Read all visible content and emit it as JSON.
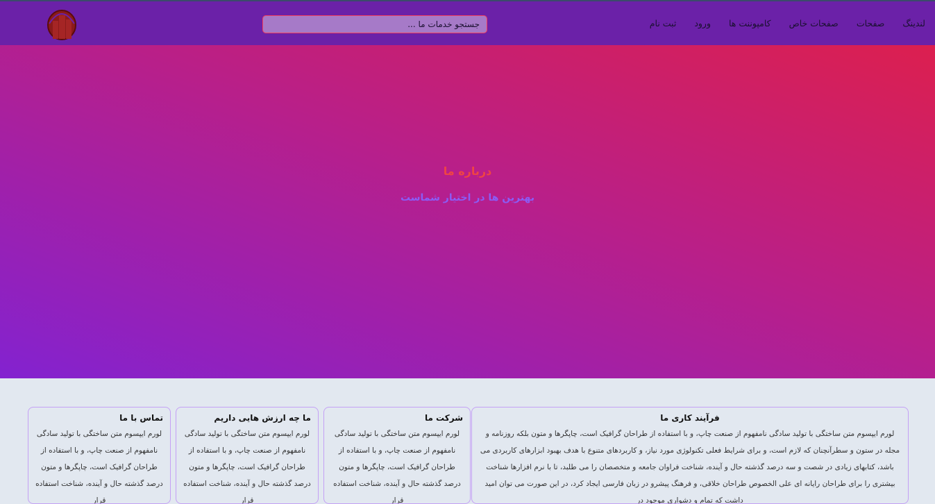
{
  "nav": {
    "menu": [
      "لندینگ",
      "صفحات",
      "صفحات خاص",
      "کامپوننت ها",
      "ورود",
      "ثبت نام"
    ],
    "search_placeholder": "جستجو خدمات ما ..."
  },
  "hero": {
    "title": "درباره ما",
    "subtitle": "بهترین ها در اختیار شماست"
  },
  "cards": [
    {
      "title": "فرآیند کاری ما",
      "text": "لورم ایپسوم متن ساختگی با تولید سادگی نامفهوم از صنعت چاپ، و با استفاده از طراحان گرافیک است، چاپگرها و متون بلکه روزنامه و مجله در ستون و سطرآنچنان که لازم است، و برای شرایط فعلی تکنولوژی مورد نیاز، و کاربردهای متنوع با هدف بهبود ابزارهای کاربردی می باشد، کتابهای زیادی در شصت و سه درصد گذشته حال و آینده، شناخت فراوان جامعه و متخصصان را می طلبد، تا با نرم افزارها شناخت بیشتری را برای طراحان رایانه ای علی الخصوص طراحان خلاقی، و فرهنگ پیشرو در زبان فارسی ایجاد کرد، در این صورت می توان امید داشت که تمام و دشواری موجود در"
    },
    {
      "title": "شرکت ما",
      "text": "لورم ایپسوم متن ساختگی با تولید سادگی نامفهوم از صنعت چاپ، و با استفاده از طراحان گرافیک است، چاپگرها و متون درصد گذشته حال و آینده، شناخت استفاده قرار"
    },
    {
      "title": "ما چه ارزش هایی داریم",
      "text": "لورم ایپسوم متن ساختگی با تولید سادگی نامفهوم از صنعت چاپ، و با استفاده از طراحان گرافیک است، چاپگرها و متون درصد گذشته حال و آینده، شناخت استفاده قرار"
    },
    {
      "title": "تماس با ما",
      "text": "لورم ایپسوم متن ساختگی با تولید سادگی نامفهوم از صنعت چاپ، و با استفاده از طراحان گرافیک است، چاپگرها و متون درصد گذشته حال و آینده، شناخت استفاده قرار"
    }
  ]
}
